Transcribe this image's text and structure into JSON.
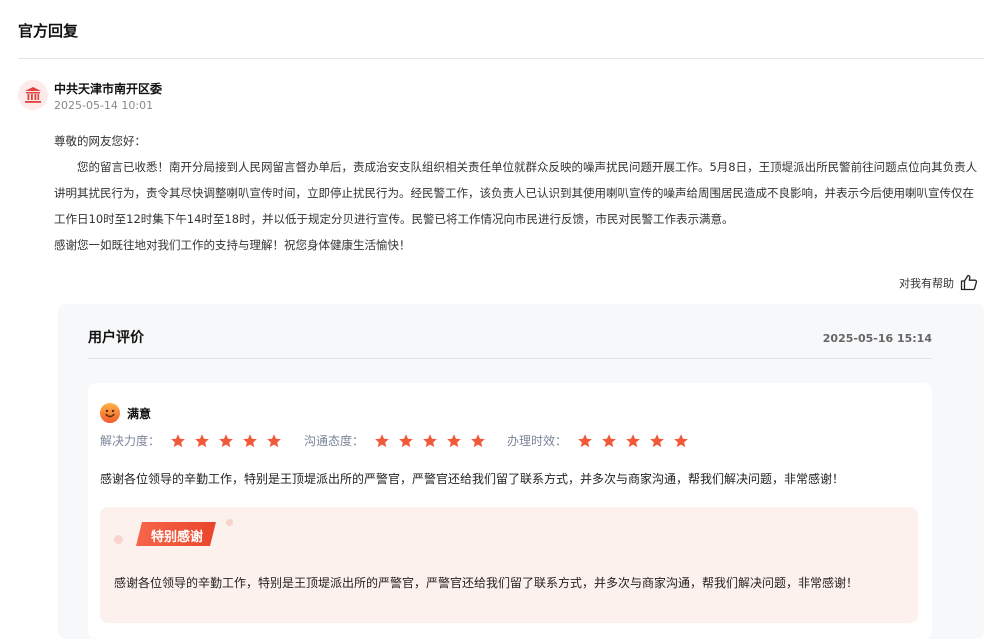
{
  "section": {
    "title": "官方回复"
  },
  "org": {
    "name": "中共天津市南开区委",
    "time": "2025-05-14 10:01",
    "icon": "government-building-icon"
  },
  "reply": {
    "greeting": "尊敬的网友您好：",
    "body": "您的留言已收悉！南开分局接到人民网留言督办单后，责成治安支队组织相关责任单位就群众反映的噪声扰民问题开展工作。5月8日，王顶堤派出所民警前往问题点位向其负责人讲明其扰民行为，责令其尽快调整喇叭宣传时间，立即停止扰民行为。经民警工作，该负责人已认识到其使用喇叭宣传的噪声给周围居民造成不良影响，并表示今后使用喇叭宣传仅在工作日10时至12时集下午14时至18时，并以低于规定分贝进行宣传。民警已将工作情况向市民进行反馈，市民对民警工作表示满意。",
    "closing": "感谢您一如既往地对我们工作的支持与理解！祝您身体健康生活愉快！"
  },
  "helpful": {
    "label": "对我有帮助",
    "icon": "thumbs-up-icon"
  },
  "evaluation": {
    "title": "用户评价",
    "time": "2025-05-16 15:14",
    "satisfaction": "满意",
    "ratings": [
      {
        "label": "解决力度：",
        "stars": 5
      },
      {
        "label": "沟通态度：",
        "stars": 5
      },
      {
        "label": "办理时效：",
        "stars": 5
      }
    ],
    "comment": "感谢各位领导的辛勤工作，特别是王顶堤派出所的严警官，严警官还给我们留了联系方式，并多次与商家沟通，帮我们解决问题，非常感谢！",
    "thanks_tag": "特别感谢",
    "thanks_text": "感谢各位领导的辛勤工作，特别是王顶堤派出所的严警官，严警官还给我们留了联系方式，并多次与商家沟通，帮我们解决问题，非常感谢！"
  },
  "colors": {
    "star": "#f05a3a",
    "accent": "#e8452c",
    "panel": "#f7f8fa",
    "thanks_bg": "#fdf1ee"
  }
}
